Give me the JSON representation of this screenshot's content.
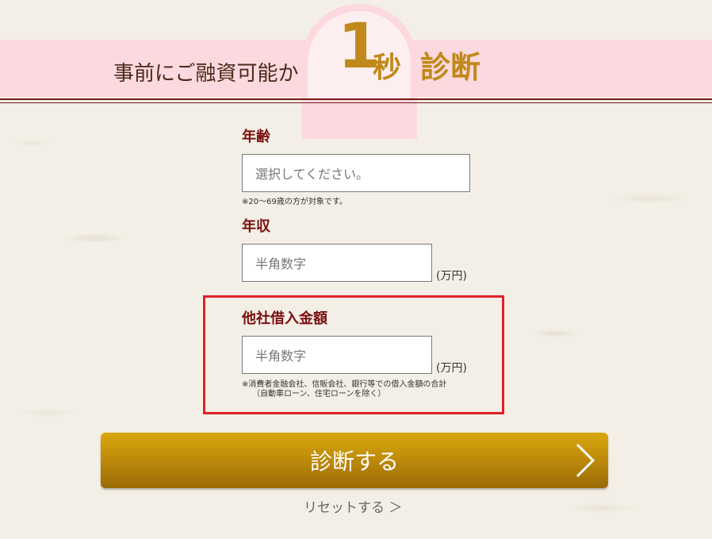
{
  "header": {
    "lead": "事前にご融資可能か",
    "one": "1",
    "sec": "秒",
    "diagnosis": "診断"
  },
  "form": {
    "age": {
      "label": "年齢",
      "placeholder": "選択してください。",
      "note": "※20～69歳の方が対象です。"
    },
    "income": {
      "label": "年収",
      "placeholder": "半角数字",
      "unit": "(万円)"
    },
    "other_loans": {
      "label": "他社借入金額",
      "placeholder": "半角数字",
      "unit": "(万円)",
      "note_line1": "※消費者金融会社、信販会社、銀行等での借入金額の合計",
      "note_line2": "（自動車ローン、住宅ローンを除く）"
    }
  },
  "actions": {
    "submit_label": "診断する",
    "reset_label": "リセットする ＞"
  },
  "colors": {
    "accent_gold": "#c0891a",
    "label_red": "#7a1010",
    "highlight": "#e0202a",
    "banner_pink": "#fbd9de"
  }
}
